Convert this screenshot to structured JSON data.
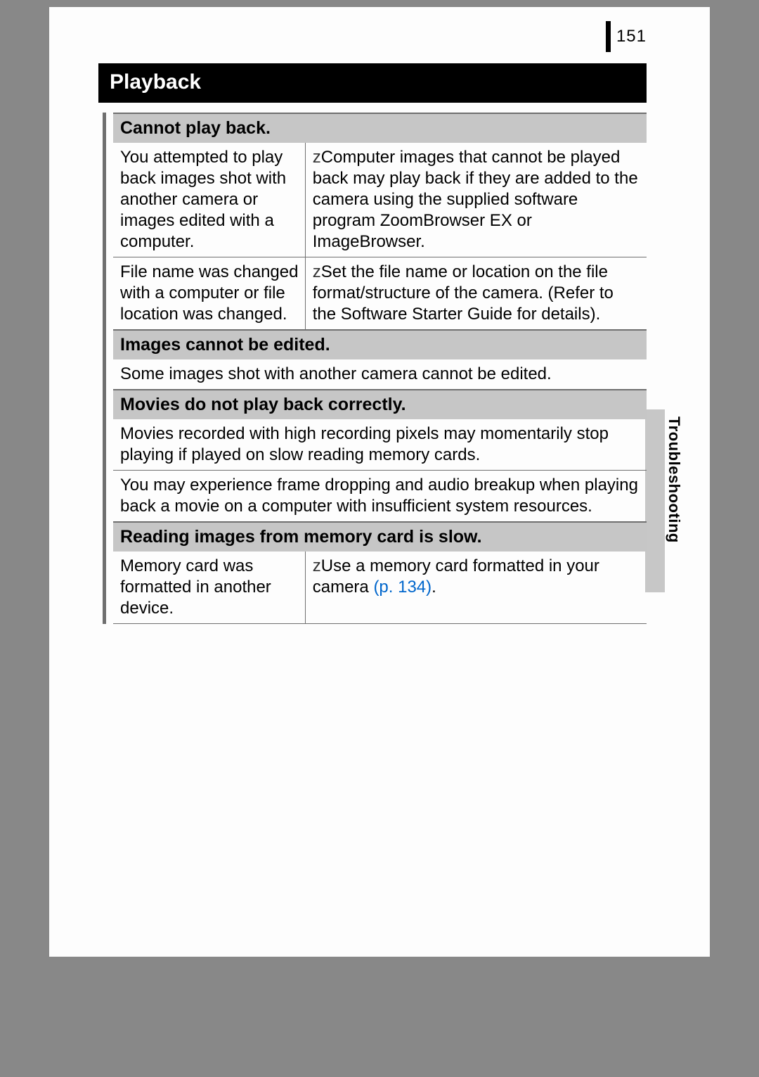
{
  "page_number": "151",
  "section_title": "Playback",
  "side_tab": "Troubleshooting",
  "bullet_glyph": "z",
  "sub1": {
    "heading": "Cannot play back.",
    "rows": [
      {
        "cause": "You attempted to play back images shot with another camera or images edited with a computer.",
        "fix": "Computer images that cannot be played back may play back if they are added to the camera using the supplied software program ZoomBrowser EX or ImageBrowser."
      },
      {
        "cause": "File name was changed with a computer or file location was changed.",
        "fix": "Set the file name or location on the file format/structure of the camera. (Refer to the Software Starter Guide for details)."
      }
    ]
  },
  "sub2": {
    "heading": "Images cannot be edited.",
    "body": "Some images shot with another camera cannot be edited."
  },
  "sub3": {
    "heading": "Movies do not play back correctly.",
    "body1": "Movies recorded with high recording pixels may momentarily stop playing if played on slow reading memory cards.",
    "body2": "You may experience frame dropping and audio breakup when playing back a movie on a computer with insufficient system resources."
  },
  "sub4": {
    "heading": "Reading images from memory card is slow.",
    "row": {
      "cause": "Memory card was formatted in another device.",
      "fix_pre": "Use a memory card formatted in your camera ",
      "fix_link": "(p. 134)",
      "fix_post": "."
    }
  }
}
